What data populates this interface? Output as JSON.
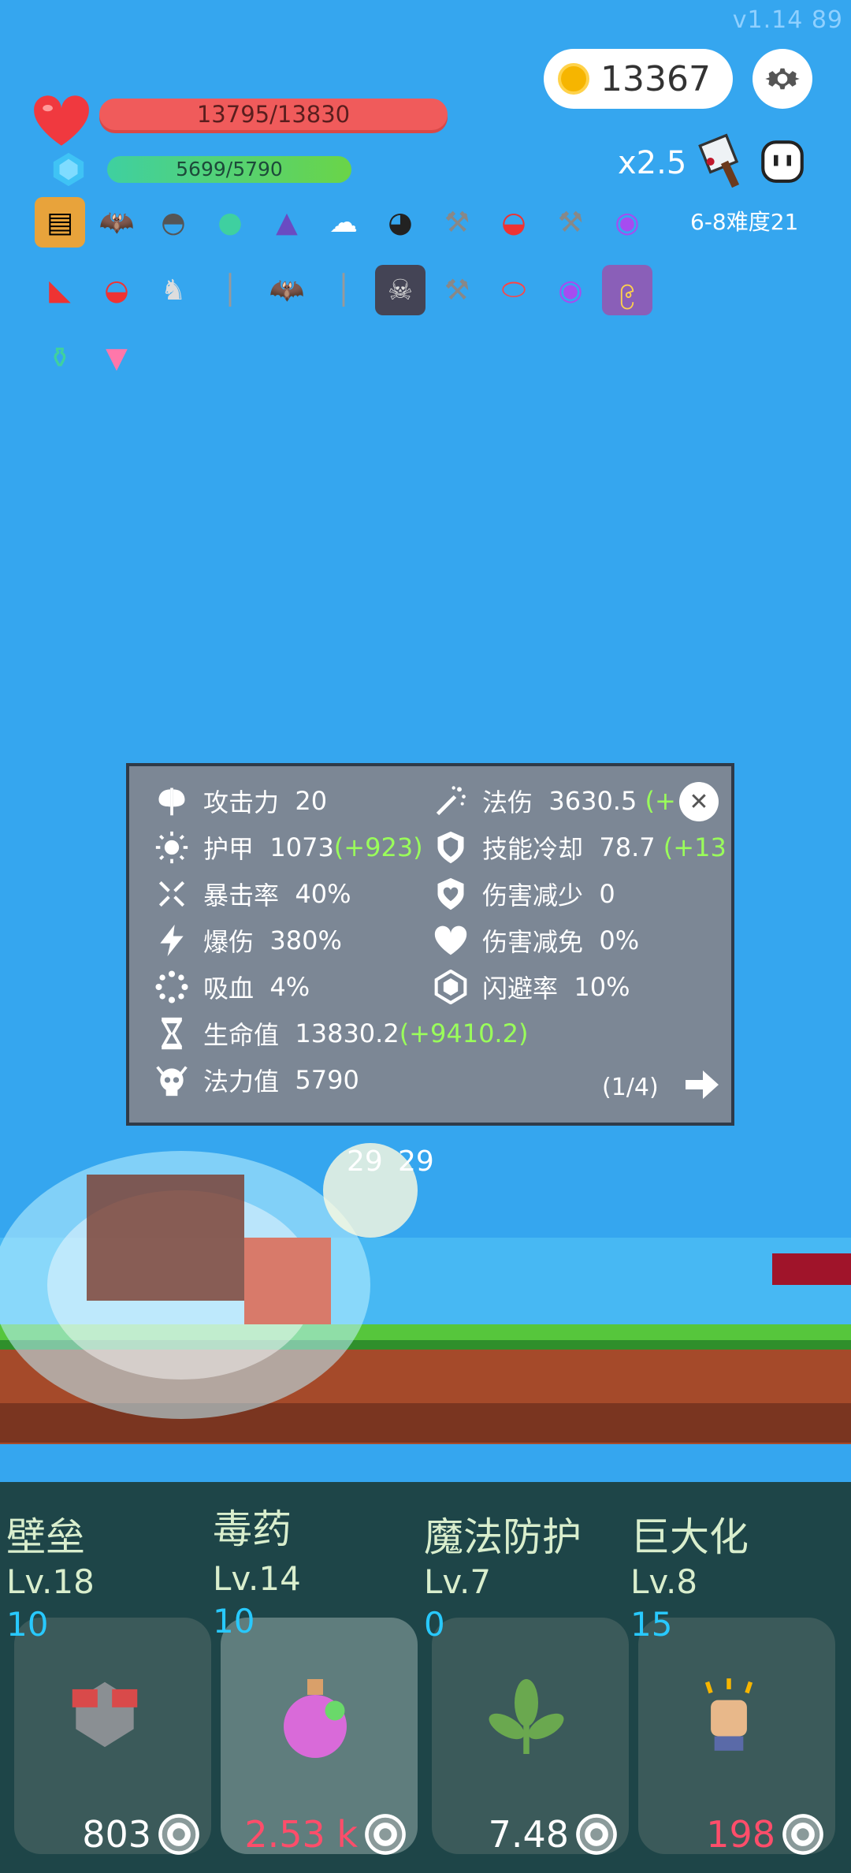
{
  "version": "v1.14   89",
  "coins": "13367",
  "hp_text": "13795/13830",
  "mp_text": "5699/5790",
  "speed": "x2.5",
  "difficulty": "6-8难度21",
  "items_row1": [
    "book-icon",
    "bat-icon",
    "mortar-icon",
    "lamp-icon",
    "wizard-hat-icon",
    "wing-icon",
    "cauldron-icon",
    "axe-icon",
    "mushroom-icon",
    "axe-icon",
    "crystal-ball-icon"
  ],
  "items_row2": [
    "boot-icon",
    "mushroom-icon",
    "unicorn-icon",
    "sword-icon",
    "bat-icon",
    "sword-icon",
    "skull-book-icon",
    "axe-icon",
    "pill-icon",
    "crystal-ball-icon",
    "spell-book-icon"
  ],
  "items_row3": [
    "potion-icon",
    "ice-cream-icon"
  ],
  "stats": {
    "attack_label": "攻击力",
    "attack_value": "20",
    "armor_label": "护甲",
    "armor_value": "1073",
    "armor_bonus": "(+923)",
    "crit_label": "暴击率",
    "crit_value": "40%",
    "critdmg_label": "爆伤",
    "critdmg_value": "380%",
    "lifesteal_label": "吸血",
    "lifesteal_value": "4%",
    "hp_label": "生命值",
    "hp_value": "13830.2",
    "hp_bonus": "(+9410.2)",
    "mp_label": "法力值",
    "mp_value": "5790",
    "magic_label": "法伤",
    "magic_value": "3630.5",
    "magic_bonus": "(+",
    "cooldown_label": "技能冷却",
    "cooldown_value": "78.7",
    "cooldown_bonus": "(+13",
    "dmgreduce_label": "伤害减少",
    "dmgreduce_value": "0",
    "dmgimmune_label": "伤害减免",
    "dmgimmune_value": "0%",
    "dodge_label": "闪避率",
    "dodge_value": "10%",
    "page": "(1/4)"
  },
  "floating_numbers": [
    "29",
    "29"
  ],
  "skills": [
    {
      "name": "壁垒",
      "level": "Lv.18",
      "count": "10",
      "price": "803",
      "price_color": "#ffffff",
      "icon": "fortress-icon"
    },
    {
      "name": "毒药",
      "level": "Lv.14",
      "count": "10",
      "price": "2.53 k",
      "price_color": "#ff4d6a",
      "icon": "poison-potion-icon"
    },
    {
      "name": "魔法防护",
      "level": "Lv.7",
      "count": "0",
      "price": "7.48",
      "price_color": "#ffffff",
      "icon": "leaf-icon"
    },
    {
      "name": "巨大化",
      "level": "Lv.8",
      "count": "15",
      "price": "198",
      "price_color": "#ff4d6a",
      "icon": "fist-icon"
    }
  ],
  "colors": {
    "sky": "#35a6ef",
    "panel": "#7c8795",
    "bonus": "#9aff5a",
    "bottom": "#1e4548"
  }
}
